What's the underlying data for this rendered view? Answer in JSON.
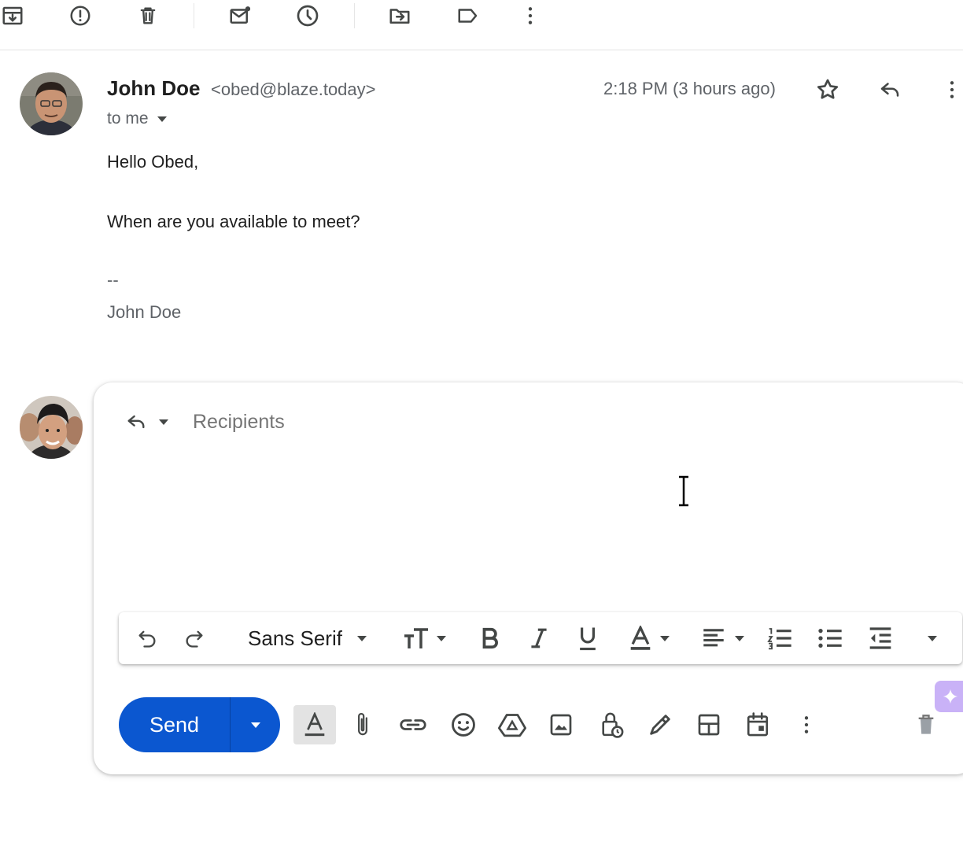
{
  "top_toolbar": {
    "icons": [
      "archive-icon",
      "report-spam-icon",
      "delete-icon",
      "mark-unread-icon",
      "snooze-icon",
      "move-to-icon",
      "label-icon",
      "more-vert-icon"
    ]
  },
  "message": {
    "sender_name": "John Doe",
    "sender_email": "<obed@blaze.today>",
    "to_label": "to me",
    "timestamp": "2:18 PM (3 hours ago)",
    "greeting": "Hello Obed,",
    "body": "When are you available to meet?",
    "signature_separator": "--",
    "signature_name": "John Doe"
  },
  "reply": {
    "recipients_placeholder": "Recipients",
    "format": {
      "font_family": "Sans Serif"
    },
    "send_label": "Send"
  },
  "colors": {
    "send_button": "#0b57d0",
    "gemini_tab": "#c9b2f7"
  }
}
